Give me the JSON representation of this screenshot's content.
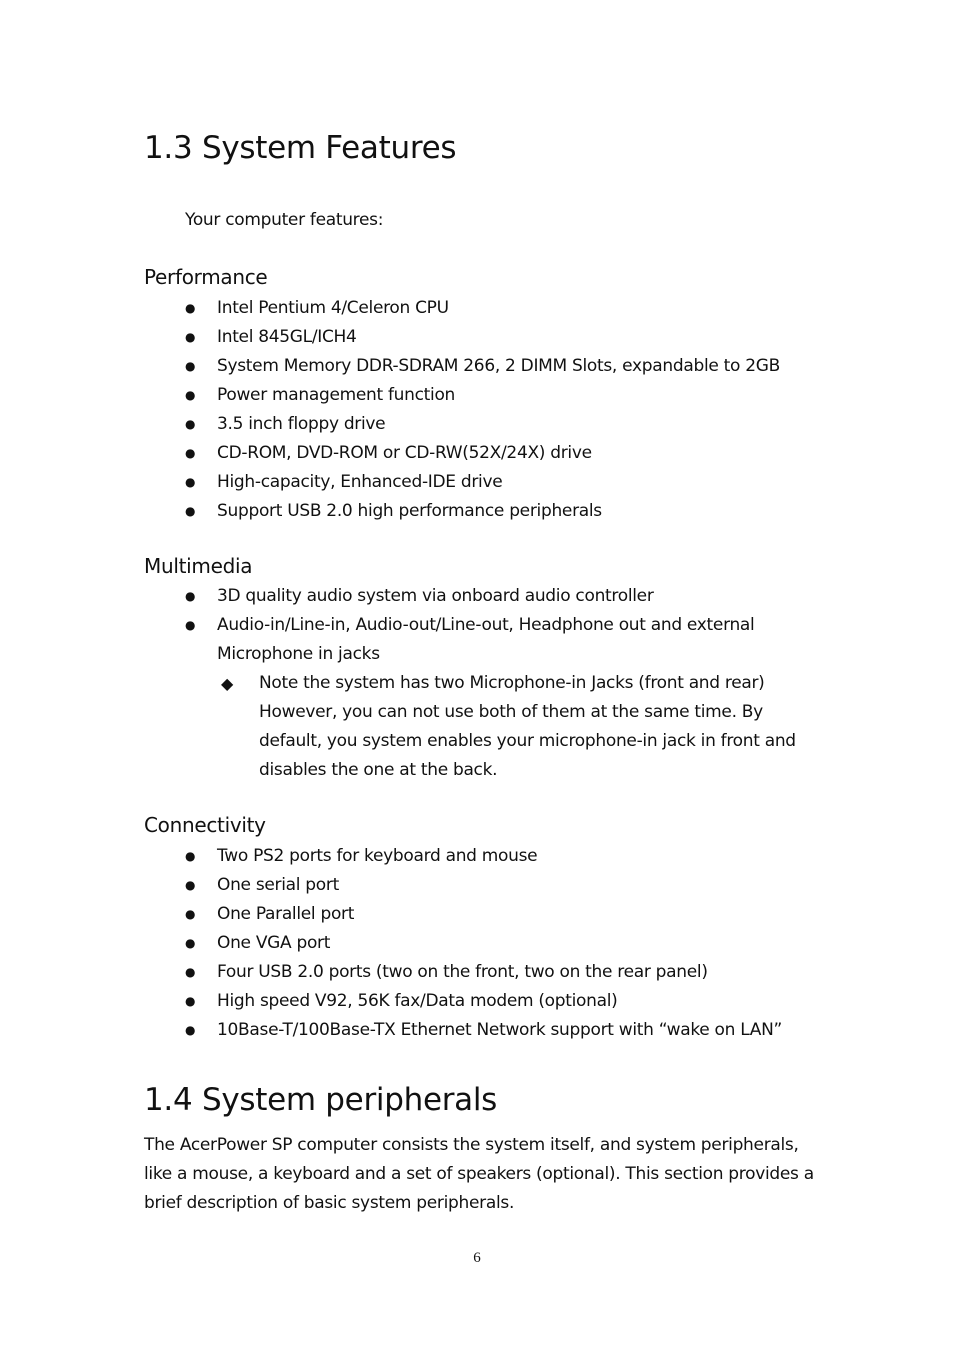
{
  "section_features": {
    "heading": "1.3 System Features",
    "intro": "Your computer features:",
    "groups": [
      {
        "title": "Performance",
        "items": [
          "Intel Pentium 4/Celeron CPU",
          "Intel 845GL/ICH4",
          "System Memory DDR-SDRAM 266, 2 DIMM Slots, expandable to 2GB",
          "Power management function",
          "3.5 inch floppy drive",
          "CD-ROM, DVD-ROM or CD-RW(52X/24X) drive",
          "High-capacity, Enhanced-IDE drive",
          "Support USB 2.0 high performance peripherals"
        ]
      },
      {
        "title": "Multimedia",
        "items": [
          "3D quality audio system via onboard audio controller",
          "Audio-in/Line-in, Audio-out/Line-out, Headphone out and external",
          "Microphone in jacks"
        ],
        "note": "Note the system has two Microphone-in Jacks (front and rear) However, you can not use both of them at the same time. By default, you system enables your microphone-in jack in front and disables the one at the back."
      },
      {
        "title": "Connectivity",
        "items": [
          "Two PS2 ports for keyboard and mouse",
          "One serial port",
          "One Parallel port",
          "One VGA port",
          "Four USB 2.0 ports (two on the front, two on the rear panel)",
          "High speed V92, 56K fax/Data modem (optional)",
          "10Base-T/100Base-TX Ethernet Network support with “wake on LAN”"
        ]
      }
    ]
  },
  "section_peripherals": {
    "heading": "1.4 System peripherals",
    "body": "The AcerPower SP computer consists the system itself, and system peripherals, like a mouse, a keyboard and a set of speakers (optional). This section provides a brief description of basic system peripherals."
  },
  "icons": {
    "bullet": "●",
    "sub_bullet": "◆"
  },
  "footer": {
    "page_number": "6"
  }
}
